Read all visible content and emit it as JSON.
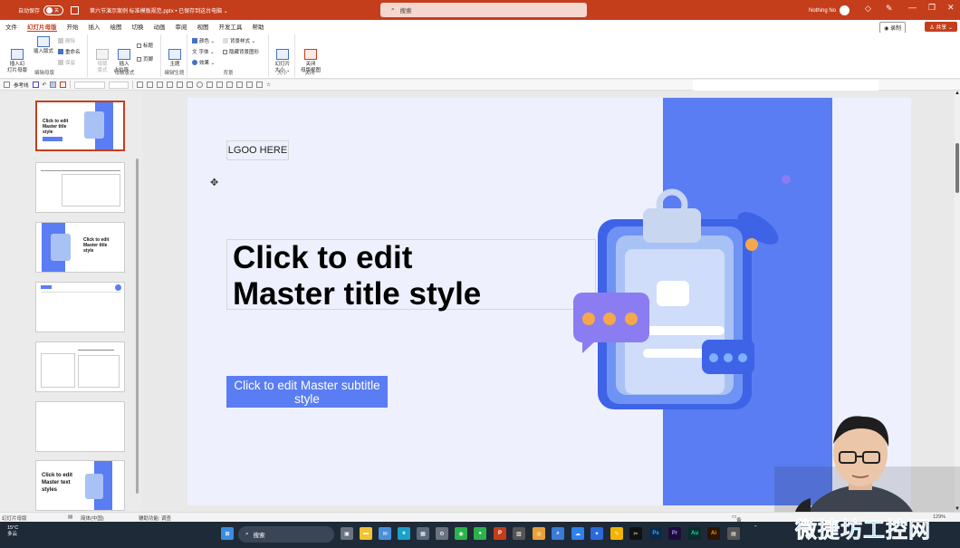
{
  "titlebar": {
    "autosave_label": "自动保存",
    "autosave_state": "关",
    "document_title": "第六节演示案例   标准模板规范.pptx • 已保存到这台电脑 ⌄",
    "search_placeholder": "搜索",
    "user_name": "Nothing No",
    "accent_color": "#c43e1c"
  },
  "menu": {
    "tabs": [
      "文件",
      "幻灯片母版",
      "开始",
      "插入",
      "绘图",
      "切换",
      "动画",
      "审阅",
      "视图",
      "开发工具",
      "帮助"
    ],
    "active_tab": "幻灯片母版",
    "record_label": "◉ 录制",
    "share_label": "♙ 共享 ⌄"
  },
  "ribbon": {
    "insert_master": "插入幻\n灯片母版",
    "insert_layout": "插入版式",
    "delete": "删除",
    "rename": "重命名",
    "preserve": "保留",
    "group_edit_master": "编辑母版",
    "master_layout": "母版\n版式",
    "insert_placeholder": "插入\n占位符 ⌄",
    "title_check": "标题",
    "footer_check": "页脚",
    "group_master_layout": "母版版式",
    "themes": "主题\n⌄",
    "group_edit_theme": "编辑主题",
    "colors": "颜色 ⌄",
    "fonts": "字体 ⌄",
    "effects": "效果 ⌄",
    "background_styles": "背景样式 ⌄",
    "hide_bg_graphics": "隐藏背景图形",
    "group_background": "背景",
    "slide_size": "幻灯片\n大小 ⌄",
    "group_size": "大小",
    "close_master_view": "关闭\n母版视图",
    "group_close": "关闭"
  },
  "quickbar": {
    "guides_label": "参考线"
  },
  "thumbnails": [
    {
      "title": "Click to edit\nMaster title\nstyle",
      "selected": true
    },
    {
      "title": "",
      "selected": false
    },
    {
      "title": "Click to edit\nMaster title\nstyle",
      "selected": false
    },
    {
      "title": "",
      "selected": false
    },
    {
      "title": "",
      "selected": false
    },
    {
      "title": "",
      "selected": false
    },
    {
      "title": "Click to edit\nMaster text\nstyles",
      "selected": false
    }
  ],
  "slide": {
    "logo_text": "LGOO HERE",
    "title": "Click to edit\nMaster title style",
    "subtitle": "Click to edit Master subtitle\nstyle",
    "brand_blue": "#5a7df3"
  },
  "statusbar": {
    "view_label": "幻灯片母版",
    "language": "简体(中国)",
    "accessibility": "辅助功能: 调查",
    "notes": "备注",
    "zoom": "129%"
  },
  "taskbar": {
    "temperature": "15°C",
    "weather": "多云",
    "search_label": "搜索",
    "apps": [
      "Ps",
      "Pr",
      "Au",
      "Ai"
    ]
  },
  "watermark": "微捷坊工控网"
}
